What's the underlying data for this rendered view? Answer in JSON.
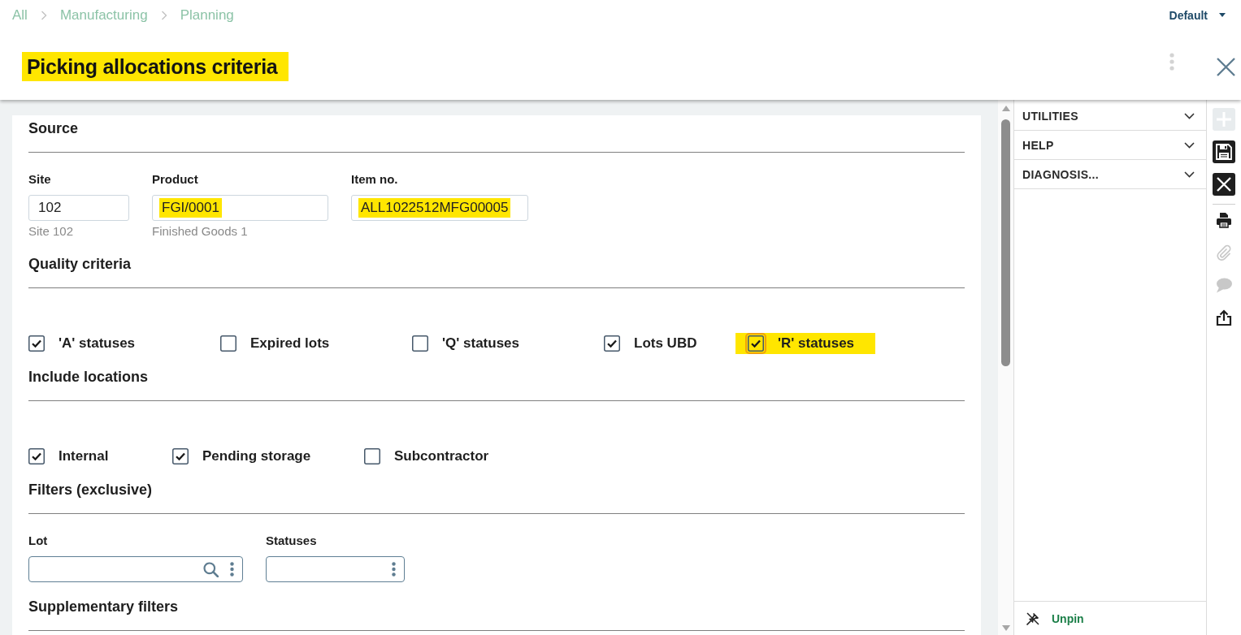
{
  "breadcrumb": [
    "All",
    "Manufacturing",
    "Planning"
  ],
  "view_selector": {
    "label": "Default"
  },
  "title": {
    "text": "Picking allocations criteria",
    "highlighted": true
  },
  "sections": [
    {
      "title": "Source",
      "kind": "fields",
      "fields": [
        {
          "label": "Site",
          "kind": "text",
          "value": "102",
          "description": "Site 102",
          "highlighted": false
        },
        {
          "label": "Product",
          "kind": "text",
          "value": "FGI/0001",
          "description": "Finished Goods 1",
          "highlighted": true
        },
        {
          "label": "Item no.",
          "kind": "text",
          "value": "ALL1022512MFG00005",
          "highlighted": true
        }
      ]
    },
    {
      "title": "Quality criteria",
      "kind": "checkboxes",
      "checkboxes": [
        {
          "label": "'A' statuses",
          "checked": true,
          "focused": false,
          "highlighted": false
        },
        {
          "label": "Expired lots",
          "checked": false,
          "focused": false,
          "highlighted": false
        },
        {
          "label": "'Q' statuses",
          "checked": false,
          "focused": false,
          "highlighted": false
        },
        {
          "label": "Lots UBD",
          "checked": true,
          "focused": false,
          "highlighted": false
        },
        {
          "label": "'R' statuses",
          "checked": true,
          "focused": true,
          "highlighted": true
        }
      ]
    },
    {
      "title": "Include locations",
      "kind": "checkboxes",
      "checkboxes": [
        {
          "label": "Internal",
          "checked": true,
          "focused": false,
          "highlighted": false
        },
        {
          "label": "Pending storage",
          "checked": true,
          "focused": false,
          "highlighted": false
        },
        {
          "label": "Subcontractor",
          "checked": false,
          "focused": false,
          "highlighted": false
        }
      ]
    },
    {
      "title": "Filters (exclusive)",
      "kind": "fields",
      "fields": [
        {
          "label": "Lot",
          "kind": "lookup",
          "highlighted": false
        },
        {
          "label": "Statuses",
          "kind": "menu",
          "highlighted": false
        }
      ]
    },
    {
      "title": "Supplementary filters"
    }
  ],
  "side_panel": {
    "sections": [
      {
        "label": "UTILITIES",
        "expanded": false
      },
      {
        "label": "HELP",
        "expanded": false
      },
      {
        "label": "DIAGNOSIS...",
        "expanded": false
      }
    ],
    "unpin": {
      "label": "Unpin"
    }
  },
  "toolbar": {
    "primary": [
      {
        "kind": "add",
        "disabled": true
      },
      {
        "kind": "save",
        "disabled": false
      },
      {
        "kind": "close",
        "disabled": false
      }
    ],
    "secondary": [
      {
        "kind": "print",
        "disabled": false
      },
      {
        "kind": "attach",
        "disabled": true
      },
      {
        "kind": "comment",
        "disabled": true
      },
      {
        "kind": "share",
        "disabled": false
      }
    ]
  }
}
